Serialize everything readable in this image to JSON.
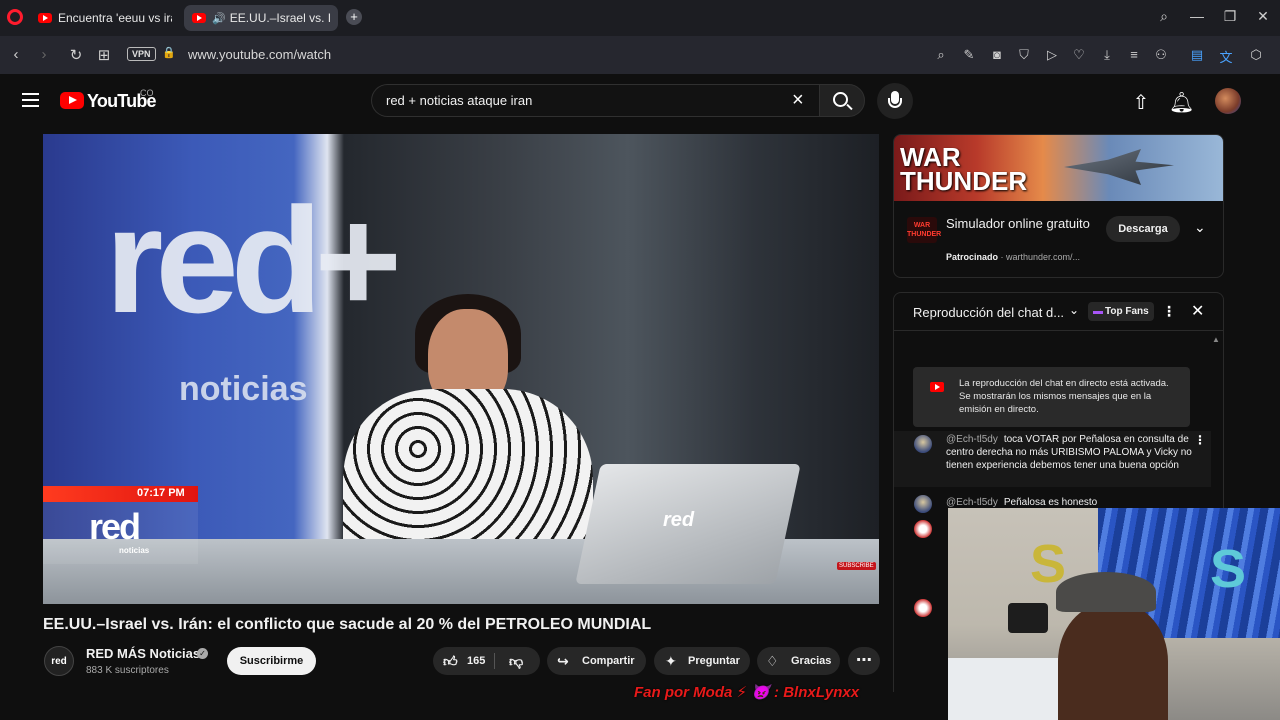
{
  "browser": {
    "tabs": [
      {
        "title": "Encuentra 'eeuu vs iran' en",
        "active": false
      },
      {
        "title": "EE.UU.–Israel vs. Irán: el",
        "active": true,
        "audio_icon": "speaker-icon"
      }
    ],
    "url": "www.youtube.com/watch",
    "vpn_label": "VPN",
    "new_tab_label": "+"
  },
  "youtube": {
    "wordmark": "YouTube",
    "country": "CO",
    "search_query": "red + noticias ataque iran"
  },
  "video": {
    "wall_logo": "red+",
    "wall_sub": "noticias",
    "bug_time": "07:17 PM",
    "bug_logo": "red",
    "bug_sub": "noticias",
    "laptop_logo": "red",
    "subscribe_mini": "SUBSCRIBE",
    "title": "EE.UU.–Israel vs. Irán: el conflicto que sacude al 20 % del PETROLEO MUNDIAL"
  },
  "channel": {
    "avatar_text": "red",
    "name": "RED MÁS Noticias",
    "subscribers": "883 K suscriptores",
    "subscribe_label": "Suscribirme",
    "verified_glyph": "✓"
  },
  "actions": {
    "likes": "165",
    "share": "Compartir",
    "ask": "Preguntar",
    "thanks": "Gracias"
  },
  "ad": {
    "banner_title_1": "WAR",
    "banner_title_2": "THUNDER",
    "logo_text_1": "WAR",
    "logo_text_2": "THUNDER",
    "title": "Simulador online gratuito",
    "sponsored": "Patrocinado",
    "domain": "warthunder.com/...",
    "cta": "Descarga"
  },
  "chat": {
    "title": "Reproducción del chat d...",
    "top_fans": "Top Fans",
    "notice": "La reproducción del chat en directo está activada. Se mostrarán los mismos mensajes que en la emisión en directo.",
    "messages": [
      {
        "author": "@Ech-tl5dy",
        "text": "toca VOTAR por Peñalosa en consulta de centro derecha no más URIBISMO PALOMA y Vicky no tienen experiencia debemos tener una buena opción"
      },
      {
        "author": "@Ech-tl5dy",
        "text": "Peñalosa es honesto"
      }
    ]
  },
  "overlay": {
    "watermark": "Fan por Moda ⚡ 👿 : BlnxLynxx",
    "balloon_left": "S",
    "balloon_right": "S"
  },
  "colors": {
    "yt_red": "#ff0000",
    "opera_red": "#ff1b2d",
    "watermark_red": "#e81a1a",
    "top_fans_purple": "#a855f7"
  }
}
